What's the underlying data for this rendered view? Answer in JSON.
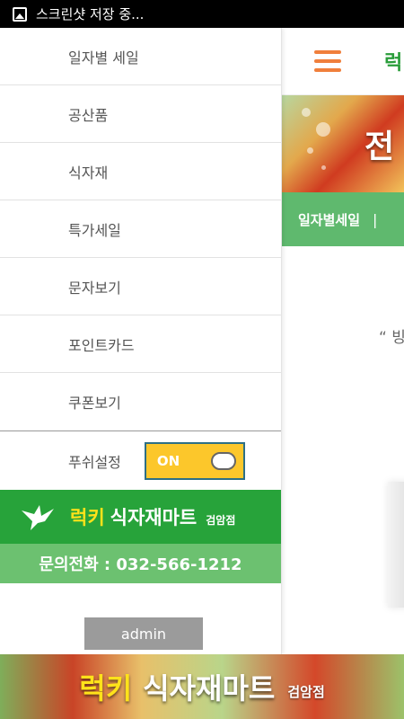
{
  "status_bar": {
    "text": "스크린샷 저장 중...",
    "icon": "image-icon"
  },
  "main": {
    "logo_text": "럭",
    "banner_text": "전",
    "nav": {
      "item": "일자별세일",
      "separator": "|"
    },
    "quote": "“ 빙"
  },
  "drawer": {
    "menu": [
      {
        "label": "일자별 세일"
      },
      {
        "label": "공산품"
      },
      {
        "label": "식자재"
      },
      {
        "label": "특가세일"
      },
      {
        "label": "문자보기"
      },
      {
        "label": "포인트카드"
      },
      {
        "label": "쿠폰보기"
      }
    ],
    "push": {
      "label": "푸쉬설정",
      "toggle": "ON"
    },
    "brand": {
      "lucky": "럭키",
      "mart": "식자재마트",
      "branch": "검암점"
    },
    "phone": "문의전화 : 032-566-1212",
    "admin": "admin"
  },
  "bottom_banner": {
    "lucky": "럭키",
    "mart": "식자재마트",
    "branch": "검암점"
  },
  "colors": {
    "accent_green": "#27a33a",
    "light_green": "#6cc170",
    "toggle_yellow": "#fcc72b",
    "hamburger_orange": "#f07f3c"
  }
}
